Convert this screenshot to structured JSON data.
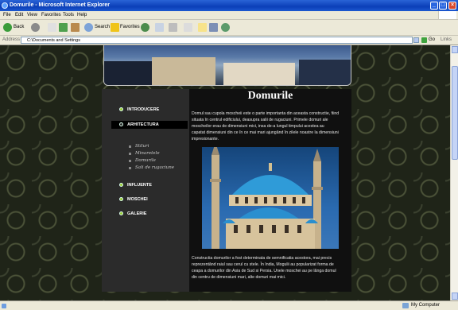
{
  "window": {
    "title": "Domurile - Microsoft Internet Explorer"
  },
  "menu": {
    "items": [
      "File",
      "Edit",
      "View",
      "Favorites",
      "Tools",
      "Help"
    ]
  },
  "toolbar": {
    "back": "Back",
    "search": "Search",
    "favorites": "Favorites"
  },
  "address": {
    "label": "Address",
    "value": "C:\\Documents and Settings",
    "go": "Go",
    "links": "Links"
  },
  "status": {
    "zone": "My Computer"
  },
  "site": {
    "nav": [
      {
        "label": "INTRODUCERE"
      },
      {
        "label": "ARHITECTURA"
      },
      {
        "label": "INFLUENTE"
      },
      {
        "label": "MOSCHEI"
      },
      {
        "label": "GALERIE"
      }
    ],
    "subnav": [
      "Stiluri",
      "Minaretele",
      "Domurile",
      "Sali de rugaciune"
    ],
    "title": "Domurile",
    "para1_lines": [
      "Domul sau cupola moscheii este o parte importanta din aceasta constructie, fiind",
      "situata în centrul edificiului, deasupra salii de rugaciuni. Primele domuri ale",
      "moscheilor erau de dimensiuni mici, insa de-a lungul timpului acestea au",
      "capatat dimensiuni din ce în ce mai mari ajungând în zilele noastre la dimensiuni",
      "impresionante."
    ],
    "para2_lines": [
      "Constructia domurilor a fost determinata de semnificatia acestora, mai precis",
      "reprezentând raiul sau cerul cu stele. În India, Mogulii au popularizat forma de",
      "ceapa a domurilor din Asia de Sud si Persia. Unele moschei au pe lânga domul",
      "din centru de dimensiuni mari, alte domuri mai mici."
    ]
  },
  "colors": {
    "titlebar": "#0b3fb8",
    "chrome": "#ece9d8",
    "page_bg": "#1f2418",
    "accent_bullet": "#9acd32"
  }
}
